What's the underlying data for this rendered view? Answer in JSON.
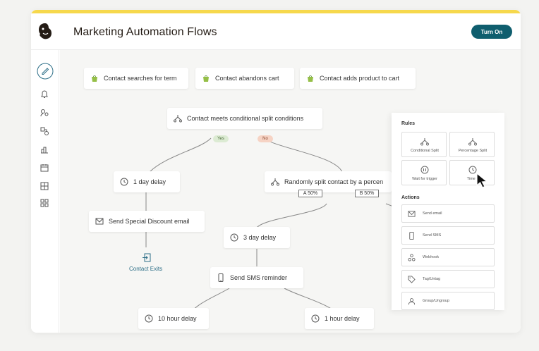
{
  "header": {
    "title": "Marketing Automation Flows",
    "turn_on_label": "Turn On"
  },
  "sidebar": {
    "icons": [
      "edit-icon",
      "bell-icon",
      "audience-icon",
      "automation-icon",
      "analytics-icon",
      "calendar-icon",
      "content-icon",
      "integrations-icon"
    ]
  },
  "triggers": [
    {
      "label": "Contact searches for term",
      "icon": "shopify-bag-icon"
    },
    {
      "label": "Contact abandons cart",
      "icon": "shopify-bag-icon"
    },
    {
      "label": "Contact adds product to cart",
      "icon": "shopify-bag-icon"
    }
  ],
  "flow": {
    "conditional_split": "Contact meets conditional split conditions",
    "yes_label": "Yes",
    "no_label": "No",
    "delay_1day": "1 day delay",
    "random_split": "Randomly split contact by a percen",
    "split_a": "A 50%",
    "split_b": "B 50%",
    "send_email": "Send Special Discount email",
    "contact_exits": "Contact Exits",
    "delay_3day": "3 day delay",
    "send_sms": "Send SMS reminder",
    "delay_10hour": "10 hour delay",
    "delay_1hour": "1 hour delay"
  },
  "panel": {
    "rules_heading": "Rules",
    "rules": [
      {
        "label": "Conditional Split",
        "icon": "split-icon"
      },
      {
        "label": "Percentage Split",
        "icon": "split-icon"
      },
      {
        "label": "Wait for trigger",
        "icon": "pause-icon"
      },
      {
        "label": "Time d",
        "icon": "clock-icon"
      }
    ],
    "actions_heading": "Actions",
    "actions": [
      {
        "label": "Send email",
        "icon": "mail-icon"
      },
      {
        "label": "Send SMS",
        "icon": "phone-icon"
      },
      {
        "label": "Webhook",
        "icon": "webhook-icon"
      },
      {
        "label": "Tag/Untag",
        "icon": "tag-icon"
      },
      {
        "label": "Group/Ungroup",
        "icon": "group-icon"
      }
    ]
  },
  "colors": {
    "accent": "#0f5e6e",
    "top_bar": "#f6d84c",
    "yes_pill": "#dcebd3",
    "no_pill": "#f6d3c4",
    "shopify": "#95bf47",
    "exit": "#2c6e87"
  }
}
